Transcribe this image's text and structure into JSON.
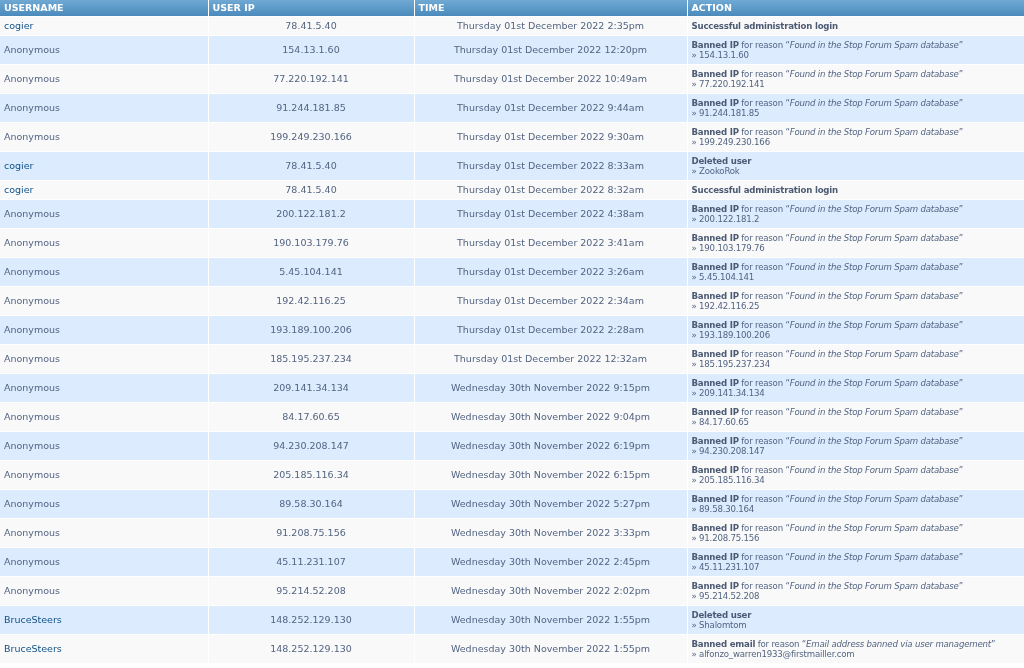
{
  "table": {
    "columns": [
      "USERNAME",
      "USER IP",
      "TIME",
      "ACTION"
    ],
    "rows": [
      {
        "username": "cogier",
        "linked": true,
        "ip": "78.41.5.40",
        "time": "Thursday 01st December 2022 2:35pm",
        "action": "**Successful administration login**"
      },
      {
        "username": "Anonymous",
        "linked": false,
        "ip": "154.13.1.60",
        "time": "Thursday 01st December 2022 12:20pm",
        "action": "**Banned IP** for reason “*Found in the Stop Forum Spam database*”",
        "detail": "» 154.13.1.60"
      },
      {
        "username": "Anonymous",
        "linked": false,
        "ip": "77.220.192.141",
        "time": "Thursday 01st December 2022 10:49am",
        "action": "**Banned IP** for reason “*Found in the Stop Forum Spam database*”",
        "detail": "» 77.220.192.141"
      },
      {
        "username": "Anonymous",
        "linked": false,
        "ip": "91.244.181.85",
        "time": "Thursday 01st December 2022 9:44am",
        "action": "**Banned IP** for reason “*Found in the Stop Forum Spam database*”",
        "detail": "» 91.244.181.85"
      },
      {
        "username": "Anonymous",
        "linked": false,
        "ip": "199.249.230.166",
        "time": "Thursday 01st December 2022 9:30am",
        "action": "**Banned IP** for reason “*Found in the Stop Forum Spam database*”",
        "detail": "» 199.249.230.166"
      },
      {
        "username": "cogier",
        "linked": true,
        "ip": "78.41.5.40",
        "time": "Thursday 01st December 2022 8:33am",
        "action": "**Deleted user**",
        "detail": "» ZookoRok"
      },
      {
        "username": "cogier",
        "linked": true,
        "ip": "78.41.5.40",
        "time": "Thursday 01st December 2022 8:32am",
        "action": "**Successful administration login**"
      },
      {
        "username": "Anonymous",
        "linked": false,
        "ip": "200.122.181.2",
        "time": "Thursday 01st December 2022 4:38am",
        "action": "**Banned IP** for reason “*Found in the Stop Forum Spam database*”",
        "detail": "» 200.122.181.2"
      },
      {
        "username": "Anonymous",
        "linked": false,
        "ip": "190.103.179.76",
        "time": "Thursday 01st December 2022 3:41am",
        "action": "**Banned IP** for reason “*Found in the Stop Forum Spam database*”",
        "detail": "» 190.103.179.76"
      },
      {
        "username": "Anonymous",
        "linked": false,
        "ip": "5.45.104.141",
        "time": "Thursday 01st December 2022 3:26am",
        "action": "**Banned IP** for reason “*Found in the Stop Forum Spam database*”",
        "detail": "» 5.45.104.141"
      },
      {
        "username": "Anonymous",
        "linked": false,
        "ip": "192.42.116.25",
        "time": "Thursday 01st December 2022 2:34am",
        "action": "**Banned IP** for reason “*Found in the Stop Forum Spam database*”",
        "detail": "» 192.42.116.25"
      },
      {
        "username": "Anonymous",
        "linked": false,
        "ip": "193.189.100.206",
        "time": "Thursday 01st December 2022 2:28am",
        "action": "**Banned IP** for reason “*Found in the Stop Forum Spam database*”",
        "detail": "» 193.189.100.206"
      },
      {
        "username": "Anonymous",
        "linked": false,
        "ip": "185.195.237.234",
        "time": "Thursday 01st December 2022 12:32am",
        "action": "**Banned IP** for reason “*Found in the Stop Forum Spam database*”",
        "detail": "» 185.195.237.234"
      },
      {
        "username": "Anonymous",
        "linked": false,
        "ip": "209.141.34.134",
        "time": "Wednesday 30th November 2022 9:15pm",
        "action": "**Banned IP** for reason “*Found in the Stop Forum Spam database*”",
        "detail": "» 209.141.34.134"
      },
      {
        "username": "Anonymous",
        "linked": false,
        "ip": "84.17.60.65",
        "time": "Wednesday 30th November 2022 9:04pm",
        "action": "**Banned IP** for reason “*Found in the Stop Forum Spam database*”",
        "detail": "» 84.17.60.65"
      },
      {
        "username": "Anonymous",
        "linked": false,
        "ip": "94.230.208.147",
        "time": "Wednesday 30th November 2022 6:19pm",
        "action": "**Banned IP** for reason “*Found in the Stop Forum Spam database*”",
        "detail": "» 94.230.208.147"
      },
      {
        "username": "Anonymous",
        "linked": false,
        "ip": "205.185.116.34",
        "time": "Wednesday 30th November 2022 6:15pm",
        "action": "**Banned IP** for reason “*Found in the Stop Forum Spam database*”",
        "detail": "» 205.185.116.34"
      },
      {
        "username": "Anonymous",
        "linked": false,
        "ip": "89.58.30.164",
        "time": "Wednesday 30th November 2022 5:27pm",
        "action": "**Banned IP** for reason “*Found in the Stop Forum Spam database*”",
        "detail": "» 89.58.30.164"
      },
      {
        "username": "Anonymous",
        "linked": false,
        "ip": "91.208.75.156",
        "time": "Wednesday 30th November 2022 3:33pm",
        "action": "**Banned IP** for reason “*Found in the Stop Forum Spam database*”",
        "detail": "» 91.208.75.156"
      },
      {
        "username": "Anonymous",
        "linked": false,
        "ip": "45.11.231.107",
        "time": "Wednesday 30th November 2022 2:45pm",
        "action": "**Banned IP** for reason “*Found in the Stop Forum Spam database*”",
        "detail": "» 45.11.231.107"
      },
      {
        "username": "Anonymous",
        "linked": false,
        "ip": "95.214.52.208",
        "time": "Wednesday 30th November 2022 2:02pm",
        "action": "**Banned IP** for reason “*Found in the Stop Forum Spam database*”",
        "detail": "» 95.214.52.208"
      },
      {
        "username": "BruceSteers",
        "linked": true,
        "ip": "148.252.129.130",
        "time": "Wednesday 30th November 2022 1:55pm",
        "action": "**Deleted user**",
        "detail": "» Shalomtom"
      },
      {
        "username": "BruceSteers",
        "linked": true,
        "ip": "148.252.129.130",
        "time": "Wednesday 30th November 2022 1:55pm",
        "action": "**Banned email** for reason “*Email address banned via user management*”",
        "detail": "» alfonzo_warren1933@firstmailler.com"
      }
    ]
  }
}
